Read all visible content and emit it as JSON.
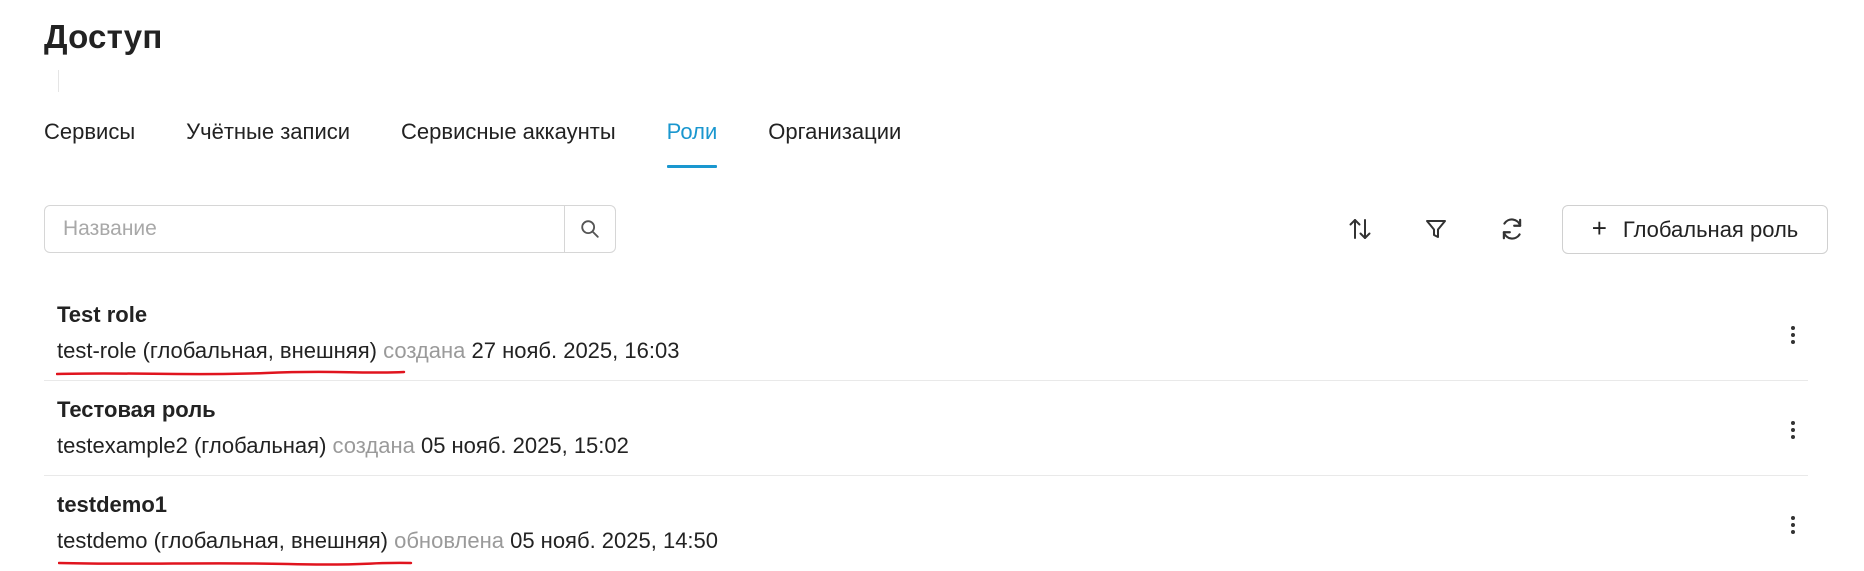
{
  "page": {
    "title": "Доступ"
  },
  "tabs": [
    {
      "label": "Сервисы",
      "active": false
    },
    {
      "label": "Учётные записи",
      "active": false
    },
    {
      "label": "Сервисные аккаунты",
      "active": false
    },
    {
      "label": "Роли",
      "active": true
    },
    {
      "label": "Организации",
      "active": false
    }
  ],
  "search": {
    "placeholder": "Название",
    "value": ""
  },
  "toolbar": {
    "sort_icon": "sort-arrows-icon",
    "filter_icon": "filter-funnel-icon",
    "refresh_icon": "refresh-icon",
    "add_label": "Глобальная роль",
    "add_icon": "plus-icon"
  },
  "roles": [
    {
      "title": "Test role",
      "id_text": "test-role (глобальная, внешняя)",
      "status": "создана",
      "date": "27 нояб. 2025, 16:03",
      "underlined": true
    },
    {
      "title": "Тестовая роль",
      "id_text": "testexample2 (глобальная)",
      "status": "создана",
      "date": "05 нояб. 2025, 15:02",
      "underlined": false
    },
    {
      "title": "testdemo1",
      "id_text": "testdemo (глобальная, внешняя)",
      "status": "обновлена",
      "date": "05 нояб. 2025, 14:50",
      "underlined": true
    }
  ],
  "colors": {
    "accent": "#1a97cf",
    "muted_text": "#9a9a9a",
    "annotation_red": "#e0141e"
  }
}
